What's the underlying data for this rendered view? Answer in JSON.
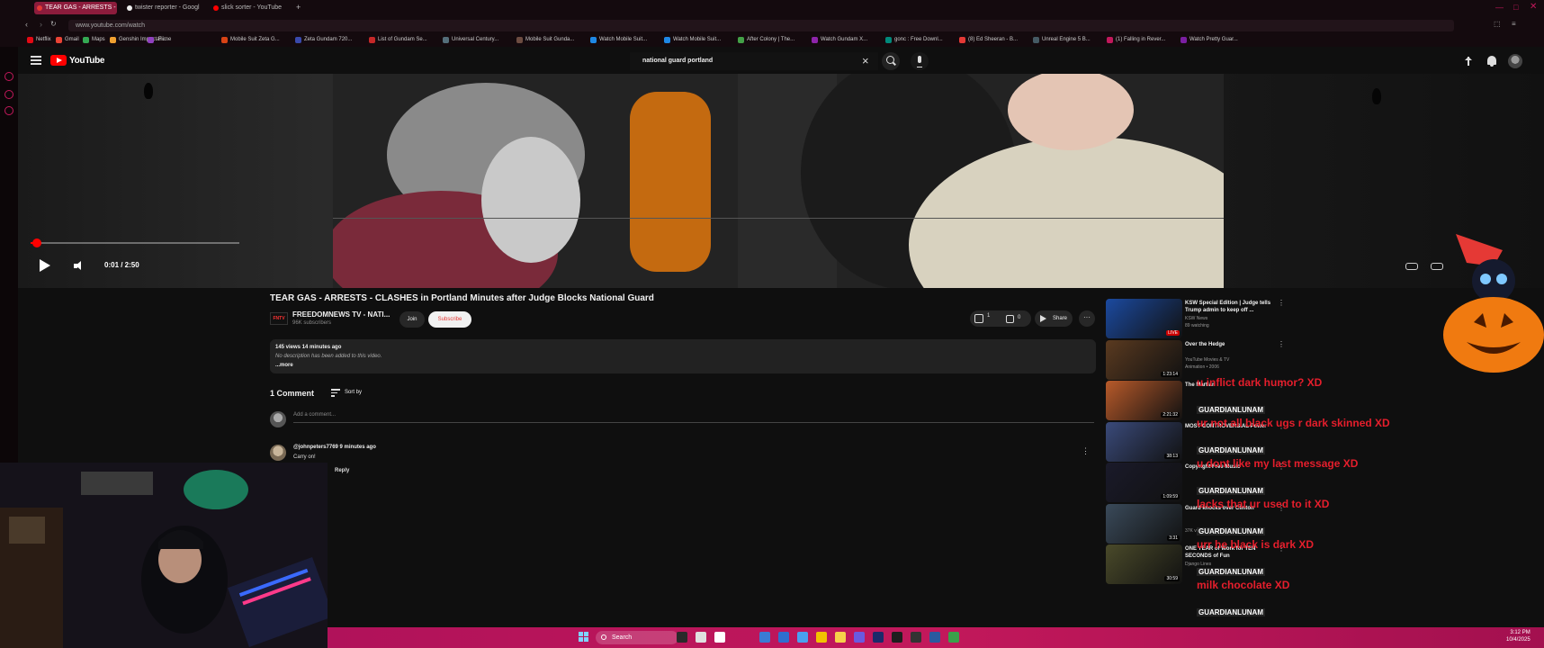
{
  "browser": {
    "tabs": [
      {
        "label": "TEAR GAS - ARRESTS -",
        "active": true,
        "color": "#e53935"
      },
      {
        "label": "twister reporter - Googl",
        "active": false,
        "color": "#eeeeee"
      },
      {
        "label": "slick sorter - YouTube",
        "active": false,
        "color": "#ff0000"
      }
    ],
    "new_tab": "+",
    "url": "www.youtube.com/watch",
    "bookmarks": [
      "Netflix",
      "Gmail",
      "Maps",
      "Genshin Impact Fi...",
      "anime",
      "Mobile Suit Zeta G...",
      "Zeta Gundam 720...",
      "List of Gundam Se...",
      "Universal Century...",
      "Mobile Suit Gunda...",
      "Watch Mobile Suit...",
      "Watch Mobile Suit...",
      "After Colony | The...",
      "Watch Gundam X...",
      "gonc : Free Downl...",
      "(8) Ed Sheeran - B...",
      "Unreal Engine 5 B...",
      "(1) Falling in Rever...",
      "Watch Pretty Guar..."
    ]
  },
  "youtube": {
    "logo_text": "YouTube",
    "search_query": "national guard portland",
    "player": {
      "time": "0:01 / 2:50",
      "progress": 0.006
    },
    "video": {
      "title": "TEAR GAS - ARRESTS - CLASHES in Portland Minutes after Judge Blocks National Guard",
      "channel": "FREEDOMNEWS TV - NATI...",
      "channel_avatar_text": "FNTV",
      "subscribers": "96K subscribers",
      "join": "Join",
      "subscribe": "Subscribe",
      "likes": "1",
      "dislikes": "0",
      "share": "Share",
      "more": "···",
      "description_meta": "145 views  14 minutes ago",
      "description_text": "No description has been added to this video.",
      "description_more": "...more"
    },
    "comments": {
      "count_label": "1 Comment",
      "sort_label": "Sort by",
      "add_placeholder": "Add a comment...",
      "items": [
        {
          "author": "@johnpeters7769 9 minutes ago",
          "text": "Carry on!",
          "reply": "Reply"
        }
      ]
    },
    "recommendations": [
      {
        "title": "KSW Special Edition | Judge tells Trump admin to keep off ...",
        "channel": "KSW News",
        "meta": "89 watching",
        "badge": "LIVE"
      },
      {
        "title": "Over the Hedge",
        "channel": "YouTube Movies & TV",
        "meta": "Animation • 2006",
        "duration": "1:23:14"
      },
      {
        "title": "The Martian",
        "channel": "",
        "meta": "",
        "duration": "2:21:32"
      },
      {
        "title": "MOST CONTROVERSIAL Power",
        "channel": "",
        "meta": "",
        "duration": "38:13"
      },
      {
        "title": "Copyright Free Music",
        "channel": "",
        "meta": "",
        "duration": "1:09:59"
      },
      {
        "title": "Guard knocks over Clinton",
        "channel": "",
        "meta": "37K views • 1 year ago",
        "duration": "3:31"
      },
      {
        "title": "ONE YEAR of Work for TEN SECONDS of Fun",
        "channel": "Django Lines",
        "meta": "",
        "duration": "30:59"
      }
    ]
  },
  "chat": [
    {
      "user": "",
      "message": "u inflict dark humor? XD"
    },
    {
      "user": "GUARDIANLUNAM",
      "message": "ur not all black ugs r dark skinned XD"
    },
    {
      "user": "GUARDIANLUNAM",
      "message": "u dont like my last message XD"
    },
    {
      "user": "GUARDIANLUNAM",
      "message": "lacks that ur used to it XD"
    },
    {
      "user": "GUARDIANLUNAM",
      "message": "urr he black is dark XD"
    },
    {
      "user": "GUARDIANLUNAM",
      "message": "milk chocolate XD"
    },
    {
      "user": "GUARDIANLUNAM",
      "message": ""
    }
  ],
  "taskbar": {
    "search_label": "Search",
    "clock_time": "3:12 PM",
    "clock_date": "10/4/2025"
  },
  "colors": {
    "accent": "#c2185b",
    "youtube_red": "#ff0000",
    "chat_red": "#e51e2c"
  }
}
